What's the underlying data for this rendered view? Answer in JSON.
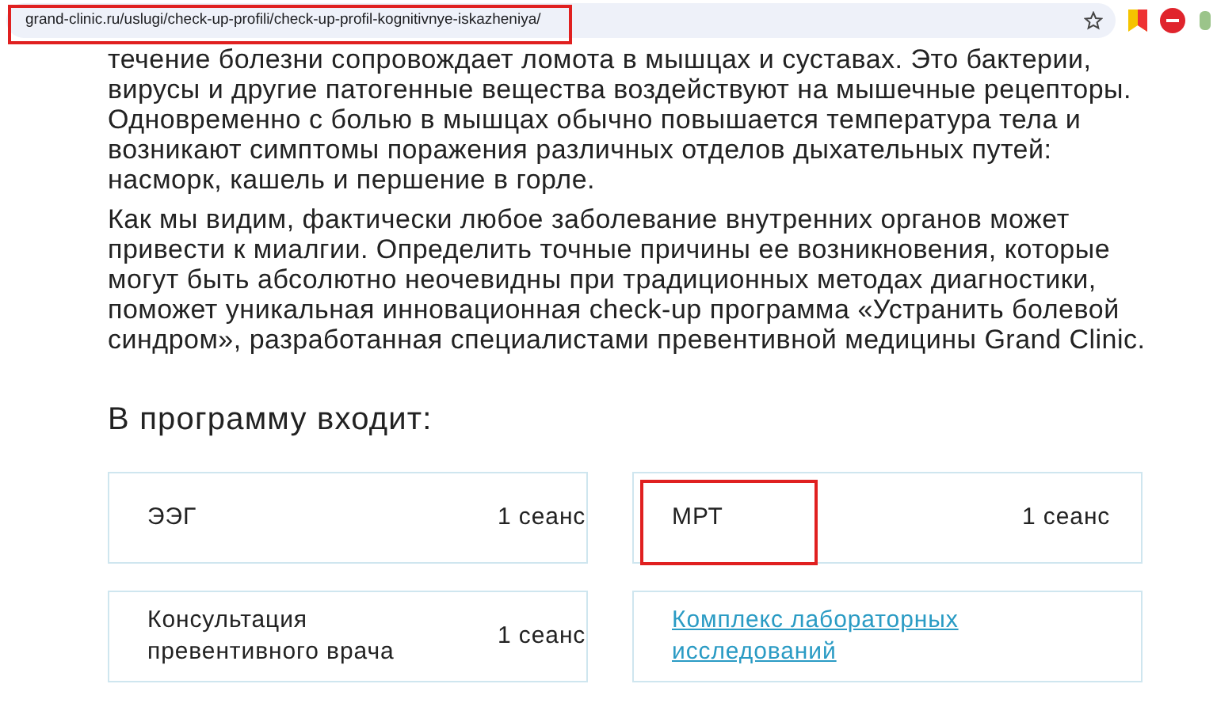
{
  "address_bar": {
    "url": "grand-clinic.ru/uslugi/check-up-profili/check-up-profil-kognitivnye-iskazheniya/",
    "highlighted": true
  },
  "paragraphs": [
    "течение болезни сопровождает ломота в мышцах и суставах. Это бактерии, вирусы и другие патогенные вещества воздействуют на мышечные рецепторы. Одновременно с болью в мышцах обычно повышается температура тела и возникают симптомы поражения различных отделов дыхательных путей: насморк, кашель и першение в горле.",
    "Как мы видим, фактически любое заболевание внутренних органов может привести к миалгии. Определить точные причины ее возникновения, которые могут быть абсолютно неочевидны при традиционных методах диагностики, поможет уникальная инновационная check-up программа «Устранить болевой синдром», разработанная специалистами превентивной медицины Grand Clinic."
  ],
  "heading": "В программу входит:",
  "items": [
    {
      "kind": "session",
      "name": "ЭЭГ",
      "count": "1 сеанс",
      "highlighted": false
    },
    {
      "kind": "session",
      "name": "МРТ",
      "count": "1 сеанс",
      "highlighted": true
    },
    {
      "kind": "session",
      "name": "Консультация превентивного врача",
      "count": "1 сеанс",
      "highlighted": false
    },
    {
      "kind": "link",
      "name": "Комплекс лабораторных исследований",
      "highlighted": false
    }
  ]
}
